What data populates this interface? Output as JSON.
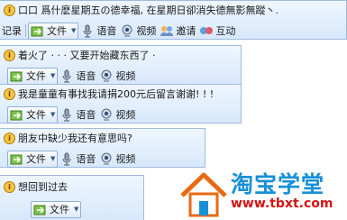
{
  "window1": {
    "status": "口口 爲什麽星期五の德幸福, 在星期日卻消失德無影無蹤丶.",
    "toolbar": {
      "record_label": "记录",
      "file_label": "文件",
      "voice_label": "语音",
      "video_label": "视频",
      "invite_label": "邀请",
      "interact_label": "互动"
    }
  },
  "window2": {
    "status": "着火了 · · · 又要开始藏东西了 ·",
    "toolbar": {
      "file_label": "文件",
      "voice_label": "语音",
      "video_label": "视频"
    }
  },
  "window3": {
    "status": "我是童童有事找我请捐200元后留言谢谢! ! !",
    "toolbar": {
      "file_label": "文件",
      "voice_label": "语音",
      "video_label": "视频"
    }
  },
  "window4": {
    "status": "朋友中缺少我还有意思吗?",
    "toolbar": {
      "file_label": "文件",
      "voice_label": "语音",
      "video_label": "视频"
    }
  },
  "window5": {
    "status": "想回到过去",
    "toolbar": {
      "file_label": "文件"
    }
  },
  "watermark": {
    "title": "淘宝学堂",
    "url": "www.tbxt.com"
  },
  "colors": {
    "panel_top": "#eef6ff",
    "panel_bottom": "#d8e8fa",
    "panel_border": "#9fbbe0",
    "watermark_blue": "#1690d8",
    "watermark_red": "#d21414"
  }
}
